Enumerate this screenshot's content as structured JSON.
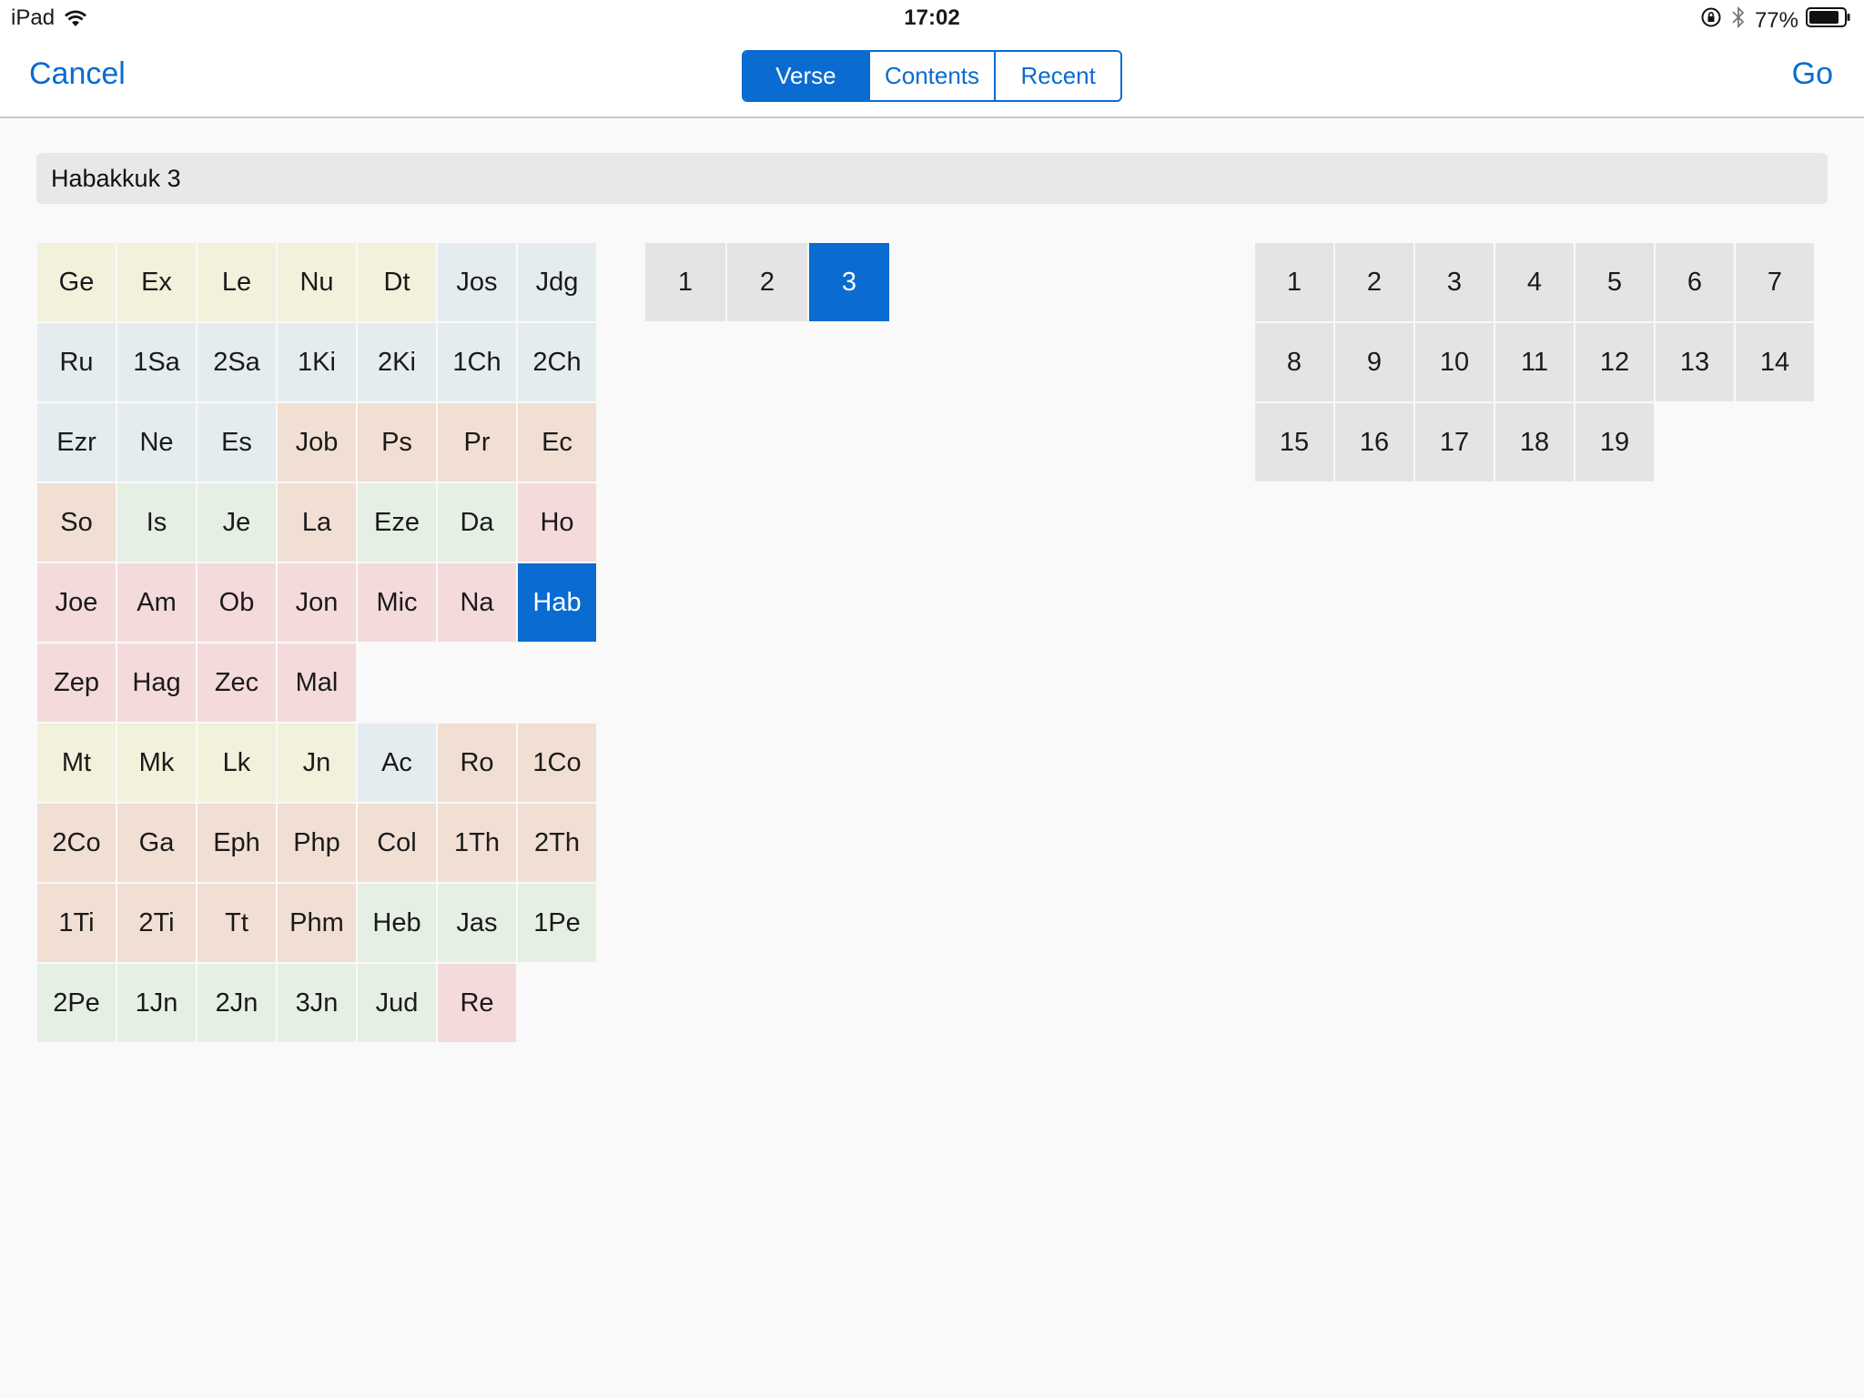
{
  "status_bar": {
    "device": "iPad",
    "time": "17:02",
    "battery": "77%",
    "icons": [
      "wifi-icon",
      "rotation-lock-icon",
      "bluetooth-icon",
      "battery-icon"
    ]
  },
  "nav": {
    "cancel": "Cancel",
    "go": "Go",
    "tabs": [
      {
        "label": "Verse",
        "active": true
      },
      {
        "label": "Contents",
        "active": false
      },
      {
        "label": "Recent",
        "active": false
      }
    ]
  },
  "reference": "Habakkuk 3",
  "colors": {
    "accent": "#0a6bd0",
    "law": "#f1f1dc",
    "history": "#e4ecef",
    "wisdom": "#f1dfd3",
    "prophet": "#e5efe3",
    "minor": "#f5dadb",
    "gray": "#e4e4e4"
  },
  "books": [
    {
      "label": "Ge",
      "group": "law"
    },
    {
      "label": "Ex",
      "group": "law"
    },
    {
      "label": "Le",
      "group": "law"
    },
    {
      "label": "Nu",
      "group": "law"
    },
    {
      "label": "Dt",
      "group": "law"
    },
    {
      "label": "Jos",
      "group": "history"
    },
    {
      "label": "Jdg",
      "group": "history"
    },
    {
      "label": "Ru",
      "group": "history"
    },
    {
      "label": "1Sa",
      "group": "history"
    },
    {
      "label": "2Sa",
      "group": "history"
    },
    {
      "label": "1Ki",
      "group": "history"
    },
    {
      "label": "2Ki",
      "group": "history"
    },
    {
      "label": "1Ch",
      "group": "history"
    },
    {
      "label": "2Ch",
      "group": "history"
    },
    {
      "label": "Ezr",
      "group": "history"
    },
    {
      "label": "Ne",
      "group": "history"
    },
    {
      "label": "Es",
      "group": "history"
    },
    {
      "label": "Job",
      "group": "wisdom"
    },
    {
      "label": "Ps",
      "group": "wisdom"
    },
    {
      "label": "Pr",
      "group": "wisdom"
    },
    {
      "label": "Ec",
      "group": "wisdom"
    },
    {
      "label": "So",
      "group": "wisdom"
    },
    {
      "label": "Is",
      "group": "prophet"
    },
    {
      "label": "Je",
      "group": "prophet"
    },
    {
      "label": "La",
      "group": "wisdom"
    },
    {
      "label": "Eze",
      "group": "prophet"
    },
    {
      "label": "Da",
      "group": "prophet"
    },
    {
      "label": "Ho",
      "group": "minor"
    },
    {
      "label": "Joe",
      "group": "minor"
    },
    {
      "label": "Am",
      "group": "minor"
    },
    {
      "label": "Ob",
      "group": "minor"
    },
    {
      "label": "Jon",
      "group": "minor"
    },
    {
      "label": "Mic",
      "group": "minor"
    },
    {
      "label": "Na",
      "group": "minor"
    },
    {
      "label": "Hab",
      "group": "minor",
      "selected": true
    },
    {
      "label": "Zep",
      "group": "minor"
    },
    {
      "label": "Hag",
      "group": "minor"
    },
    {
      "label": "Zec",
      "group": "minor"
    },
    {
      "label": "Mal",
      "group": "minor"
    },
    {
      "label": "",
      "group": "blank"
    },
    {
      "label": "",
      "group": "blank"
    },
    {
      "label": "",
      "group": "blank"
    },
    {
      "label": "Mt",
      "group": "law"
    },
    {
      "label": "Mk",
      "group": "law"
    },
    {
      "label": "Lk",
      "group": "law"
    },
    {
      "label": "Jn",
      "group": "law"
    },
    {
      "label": "Ac",
      "group": "history"
    },
    {
      "label": "Ro",
      "group": "wisdom"
    },
    {
      "label": "1Co",
      "group": "wisdom"
    },
    {
      "label": "2Co",
      "group": "wisdom"
    },
    {
      "label": "Ga",
      "group": "wisdom"
    },
    {
      "label": "Eph",
      "group": "wisdom"
    },
    {
      "label": "Php",
      "group": "wisdom"
    },
    {
      "label": "Col",
      "group": "wisdom"
    },
    {
      "label": "1Th",
      "group": "wisdom"
    },
    {
      "label": "2Th",
      "group": "wisdom"
    },
    {
      "label": "1Ti",
      "group": "wisdom"
    },
    {
      "label": "2Ti",
      "group": "wisdom"
    },
    {
      "label": "Tt",
      "group": "wisdom"
    },
    {
      "label": "Phm",
      "group": "wisdom"
    },
    {
      "label": "Heb",
      "group": "prophet"
    },
    {
      "label": "Jas",
      "group": "prophet"
    },
    {
      "label": "1Pe",
      "group": "prophet"
    },
    {
      "label": "2Pe",
      "group": "prophet"
    },
    {
      "label": "1Jn",
      "group": "prophet"
    },
    {
      "label": "2Jn",
      "group": "prophet"
    },
    {
      "label": "3Jn",
      "group": "prophet"
    },
    {
      "label": "Jud",
      "group": "prophet"
    },
    {
      "label": "Re",
      "group": "minor"
    }
  ],
  "chapters": [
    "1",
    "2",
    "3"
  ],
  "selected_chapter": "3",
  "verses": [
    "1",
    "2",
    "3",
    "4",
    "5",
    "6",
    "7",
    "8",
    "9",
    "10",
    "11",
    "12",
    "13",
    "14",
    "15",
    "16",
    "17",
    "18",
    "19"
  ]
}
